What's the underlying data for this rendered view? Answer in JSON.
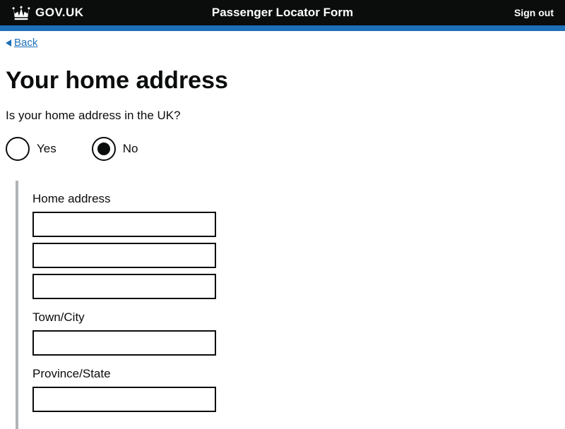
{
  "header": {
    "site_name": "GOV.UK",
    "title": "Passenger Locator Form",
    "sign_out": "Sign out"
  },
  "back_link": "Back",
  "page": {
    "heading": "Your home address",
    "question": "Is your home address in the UK?"
  },
  "radios": {
    "yes": {
      "label": "Yes",
      "checked": false
    },
    "no": {
      "label": "No",
      "checked": true
    }
  },
  "fields": {
    "home_address": {
      "label": "Home address",
      "line1": "",
      "line2": "",
      "line3": ""
    },
    "town_city": {
      "label": "Town/City",
      "value": ""
    },
    "province_state": {
      "label": "Province/State",
      "value": ""
    }
  }
}
